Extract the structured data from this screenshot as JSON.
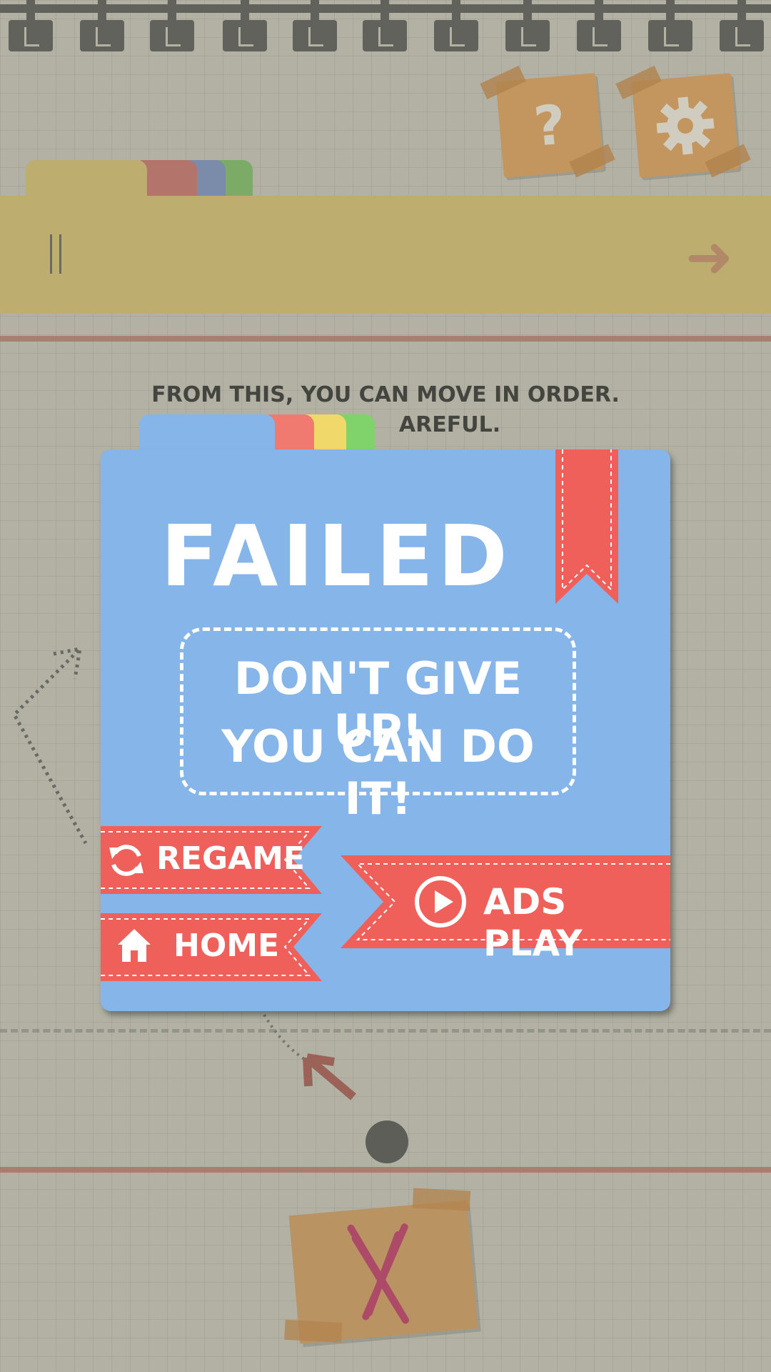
{
  "top_buttons": {
    "help_icon": "question-icon",
    "settings_icon": "gear-icon"
  },
  "instruction": {
    "line1": "FROM THIS, YOU CAN MOVE IN ORDER.",
    "line2": "AREFUL."
  },
  "dialog": {
    "title": "FAILED",
    "message_line1": "DON'T GIVE UP!",
    "message_line2": "YOU CAN DO IT!",
    "regame_label": "REGAME",
    "home_label": "HOME",
    "ads_play_label": "ADS PLAY",
    "colors": {
      "panel": "#86b5ea",
      "ribbon": "#f0605a",
      "text": "#ffffff"
    }
  },
  "bottom": {
    "reject_icon": "x-mark-icon"
  }
}
